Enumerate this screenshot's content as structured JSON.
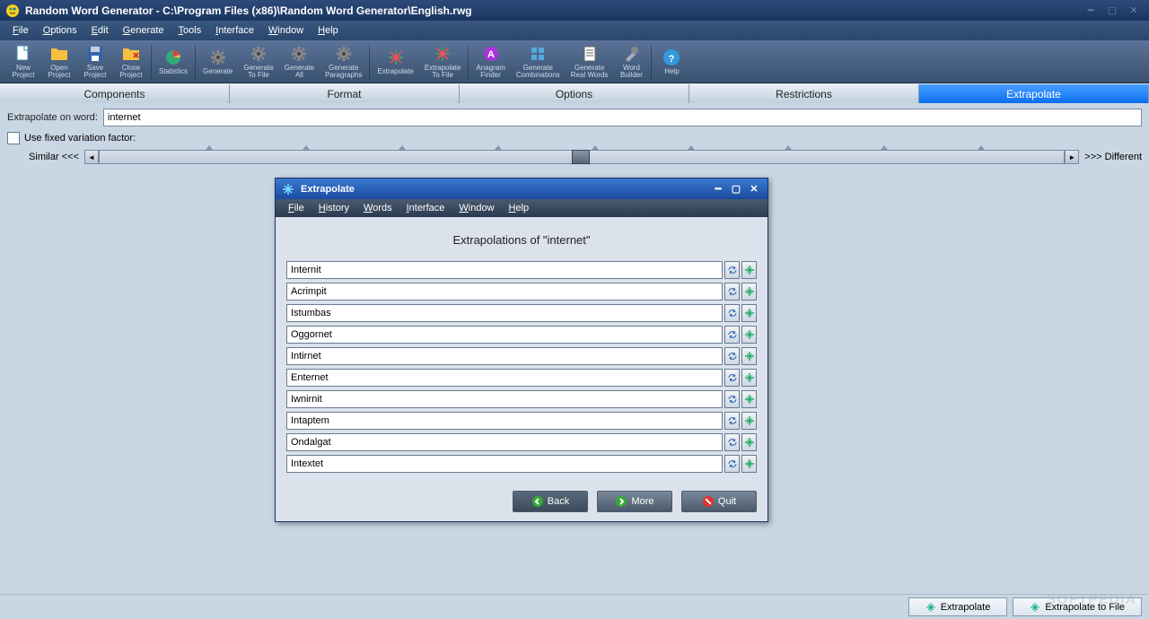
{
  "title": "Random Word Generator - C:\\Program Files (x86)\\Random Word Generator\\English.rwg",
  "menubar": [
    "File",
    "Options",
    "Edit",
    "Generate",
    "Tools",
    "Interface",
    "Window",
    "Help"
  ],
  "toolbar": [
    {
      "label": "New\nProject",
      "icon": "file"
    },
    {
      "label": "Open\nProject",
      "icon": "folder"
    },
    {
      "label": "Save\nProject",
      "icon": "disk"
    },
    {
      "label": "Close\nProject",
      "icon": "folder-x"
    },
    {
      "sep": true
    },
    {
      "label": "Statistics",
      "icon": "pie"
    },
    {
      "sep": true
    },
    {
      "label": "Generate",
      "icon": "gear"
    },
    {
      "label": "Generate\nTo File",
      "icon": "gear"
    },
    {
      "label": "Generate\nAll",
      "icon": "gear"
    },
    {
      "label": "Generate\nParagraphs",
      "icon": "gear"
    },
    {
      "sep": true
    },
    {
      "label": "Extrapolate",
      "icon": "arrows"
    },
    {
      "label": "Extrapolate\nTo File",
      "icon": "arrows"
    },
    {
      "sep": true
    },
    {
      "label": "Anagram\nFinder",
      "icon": "badge"
    },
    {
      "label": "Generate\nCombinations",
      "icon": "grid"
    },
    {
      "label": "Generate\nReal Words",
      "icon": "page"
    },
    {
      "label": "Word\nBuilder",
      "icon": "tools"
    },
    {
      "sep": true
    },
    {
      "label": "Help",
      "icon": "help"
    }
  ],
  "tabs": [
    "Components",
    "Format",
    "Options",
    "Restrictions",
    "Extrapolate"
  ],
  "active_tab": 4,
  "extrapolate_label": "Extrapolate on word:",
  "extrapolate_value": "internet",
  "fixed_factor_label": "Use fixed variation factor:",
  "slider_left": "Similar <<<",
  "slider_right": ">>> Different",
  "dialog": {
    "title": "Extrapolate",
    "menu": [
      "File",
      "History",
      "Words",
      "Interface",
      "Window",
      "Help"
    ],
    "heading": "Extrapolations of \"internet\"",
    "results": [
      "Internit",
      "Acrimpit",
      "Istumbas",
      "Oggornet",
      "Intirnet",
      "Enternet",
      "Iwnirnit",
      "Intaptem",
      "Ondalgat",
      "Intextet"
    ],
    "back": "Back",
    "more": "More",
    "quit": "Quit"
  },
  "footer_extrapolate": "Extrapolate",
  "footer_extrapolate_file": "Extrapolate to File",
  "watermark": "SOFTPEDIA"
}
